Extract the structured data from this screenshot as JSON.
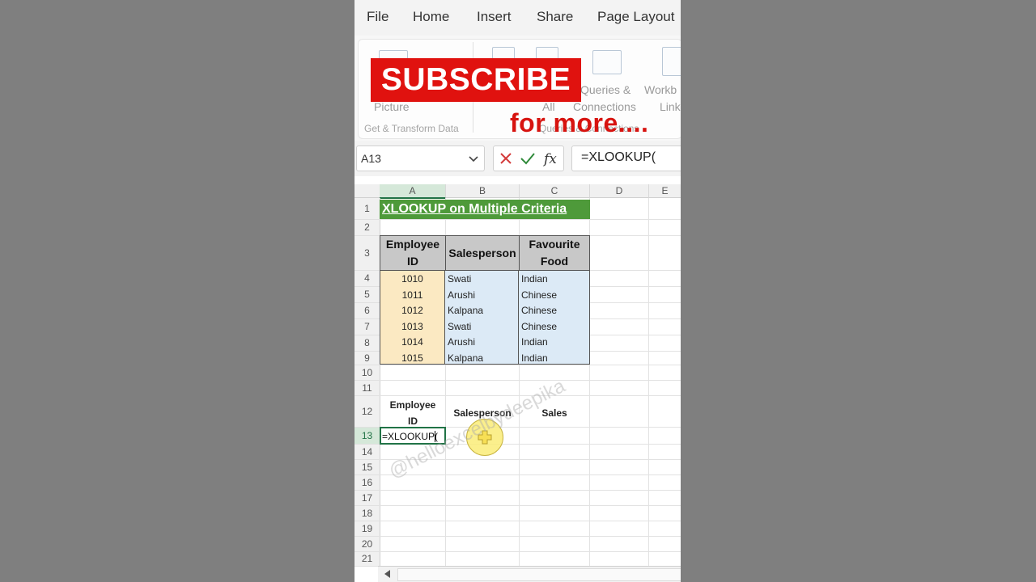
{
  "menu": [
    "File",
    "Home",
    "Insert",
    "Share",
    "Page Layout"
  ],
  "ribbon": {
    "left_text_1": "Picture",
    "left_group": "Get & Transform Data",
    "queries_line1": "Queries &",
    "queries_line2": "Connections",
    "all_label": "All",
    "workbook_line1": "Workb",
    "workbook_line2": "Link",
    "right_group": "Queries & Connections",
    "subscribe_banner": "SUBSCRIBE",
    "for_more": "for more...."
  },
  "formula_bar": {
    "name_box": "A13",
    "formula": "=XLOOKUP("
  },
  "columns": [
    "A",
    "B",
    "C",
    "D",
    "E"
  ],
  "rows": [
    "1",
    "2",
    "3",
    "4",
    "5",
    "6",
    "7",
    "8",
    "9",
    "10",
    "11",
    "12",
    "13",
    "14",
    "15",
    "16",
    "17",
    "18",
    "19",
    "20",
    "21"
  ],
  "sheet": {
    "title": "XLOOKUP on Multiple Criteria",
    "headers": [
      "Employee ID",
      "Salesperson",
      "Favourite Food"
    ],
    "data": [
      {
        "id": "1010",
        "salesperson": "Swati",
        "food": "Indian"
      },
      {
        "id": "1011",
        "salesperson": "Arushi",
        "food": "Chinese"
      },
      {
        "id": "1012",
        "salesperson": "Kalpana",
        "food": "Chinese"
      },
      {
        "id": "1013",
        "salesperson": "Swati",
        "food": "Chinese"
      },
      {
        "id": "1014",
        "salesperson": "Arushi",
        "food": "Indian"
      },
      {
        "id": "1015",
        "salesperson": "Kalpana",
        "food": "Indian"
      }
    ],
    "lookup_labels": {
      "employee": "Employee ID",
      "salesperson": "Salesperson",
      "sales": "Sales"
    },
    "active_cell_text": "=XLOOKUP("
  },
  "watermark": "@helloexcelbydeepika",
  "colors": {
    "subscribe_red": "#e0120f",
    "title_green": "#4e9a3a",
    "id_fill": "#fbe9c2",
    "blue_fill": "#dceaf6",
    "header_gray": "#c8c8c8"
  }
}
